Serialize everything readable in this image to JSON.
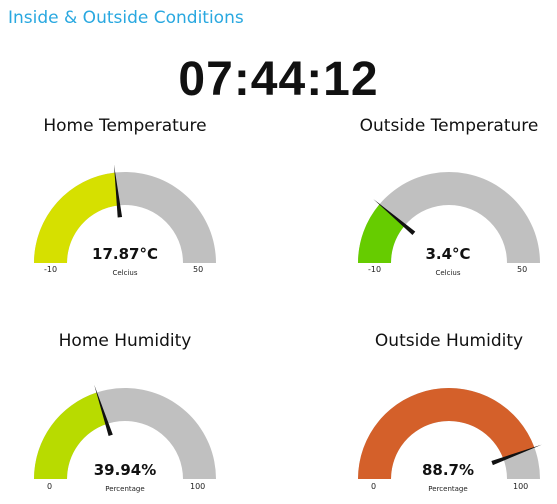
{
  "header": {
    "title": "Inside & Outside Conditions"
  },
  "clock": {
    "time": "07:44:12"
  },
  "gauges": [
    {
      "title": "Home Temperature",
      "value": 17.87,
      "value_text": "17.87°C",
      "unit": "Celcius",
      "min": -10,
      "max": 50,
      "min_label": "-10",
      "max_label": "50",
      "color": "#d6e000"
    },
    {
      "title": "Outside Temperature",
      "value": 3.4,
      "value_text": "3.4°C",
      "unit": "Celcius",
      "min": -10,
      "max": 50,
      "min_label": "-10",
      "max_label": "50",
      "color": "#66cc00"
    },
    {
      "title": "Home Humidity",
      "value": 39.94,
      "value_text": "39.94%",
      "unit": "Percentage",
      "min": 0,
      "max": 100,
      "min_label": "0",
      "max_label": "100",
      "color": "#b8db00"
    },
    {
      "title": "Outside Humidity",
      "value": 88.7,
      "value_text": "88.7%",
      "unit": "Percentage",
      "min": 0,
      "max": 100,
      "min_label": "0",
      "max_label": "100",
      "color": "#d4602a"
    }
  ],
  "colors": {
    "track": "#c0c0c0",
    "needle": "#111111",
    "title": "#29a8e0"
  }
}
